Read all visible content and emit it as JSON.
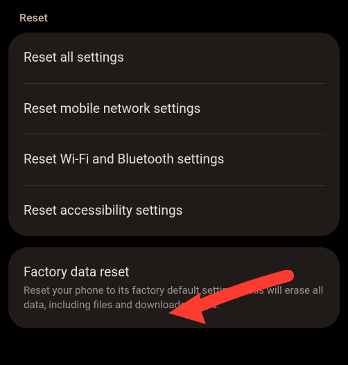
{
  "section_header": "Reset",
  "card1": {
    "items": [
      {
        "title": "Reset all settings"
      },
      {
        "title": "Reset mobile network settings"
      },
      {
        "title": "Reset Wi-Fi and Bluetooth settings"
      },
      {
        "title": "Reset accessibility settings"
      }
    ]
  },
  "card2": {
    "item": {
      "title": "Factory data reset",
      "subtitle": "Reset your phone to its factory default settings. This will erase all data, including files and downloaded apps."
    }
  }
}
